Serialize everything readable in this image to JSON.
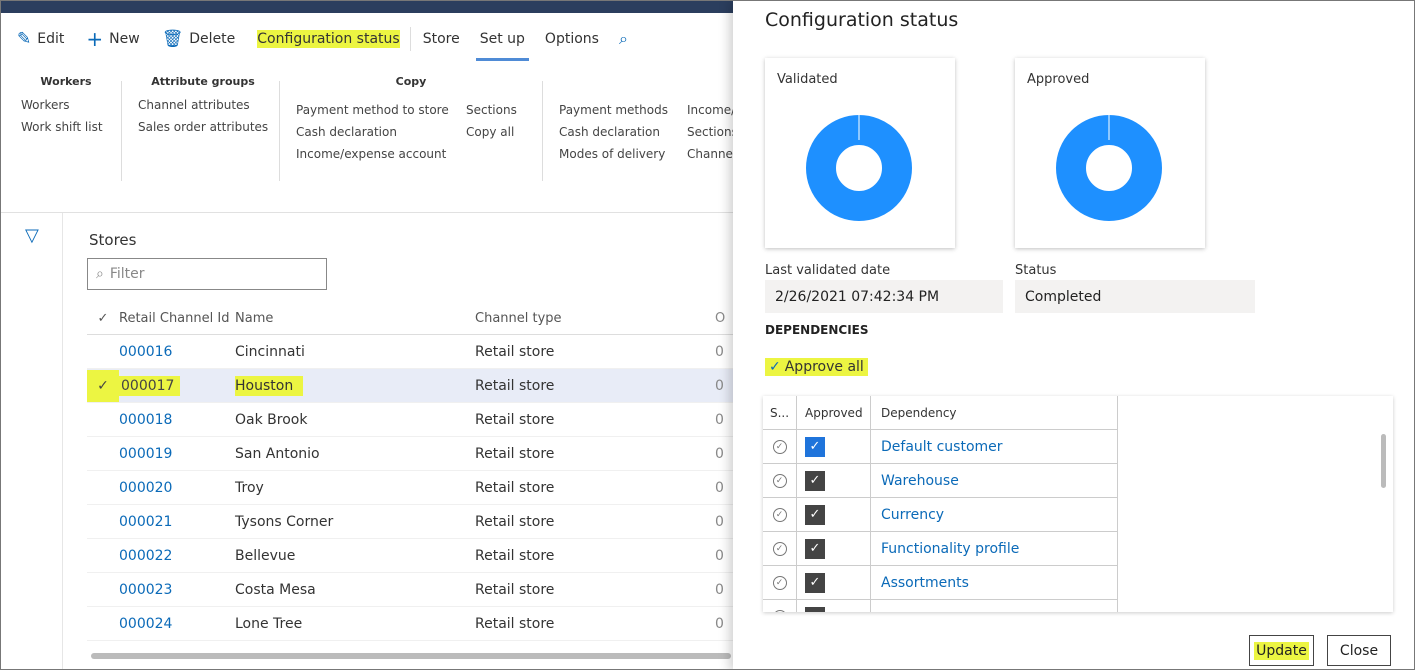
{
  "toolbar": {
    "edit": "Edit",
    "new": "New",
    "delete": "Delete",
    "config_status": "Configuration status",
    "tabs": [
      "Store",
      "Set up",
      "Options"
    ]
  },
  "ribbon": {
    "workers": {
      "header": "Workers",
      "items": [
        "Workers",
        "Work shift list"
      ]
    },
    "attribute_groups": {
      "header": "Attribute groups",
      "items": [
        "Channel attributes",
        "Sales order attributes"
      ]
    },
    "copy": {
      "header": "Copy",
      "col1": [
        "Payment method to store",
        "Cash declaration",
        "Income/expense account"
      ],
      "col2": [
        "Sections",
        "Copy all"
      ]
    },
    "col4": [
      "Payment methods",
      "Cash declaration",
      "Modes of delivery"
    ],
    "col5": [
      "Income/",
      "Sections",
      "Channe"
    ]
  },
  "stores": {
    "title": "Stores",
    "filter_placeholder": "Filter",
    "columns": [
      "Retail Channel Id",
      "Name",
      "Channel type",
      "O"
    ],
    "rows": [
      {
        "id": "000016",
        "name": "Cincinnati",
        "type": "Retail store",
        "extra": "0"
      },
      {
        "id": "000017",
        "name": "Houston",
        "type": "Retail store",
        "extra": "0"
      },
      {
        "id": "000018",
        "name": "Oak Brook",
        "type": "Retail store",
        "extra": "0"
      },
      {
        "id": "000019",
        "name": "San Antonio",
        "type": "Retail store",
        "extra": "0"
      },
      {
        "id": "000020",
        "name": "Troy",
        "type": "Retail store",
        "extra": "0"
      },
      {
        "id": "000021",
        "name": "Tysons Corner",
        "type": "Retail store",
        "extra": "0"
      },
      {
        "id": "000022",
        "name": "Bellevue",
        "type": "Retail store",
        "extra": "0"
      },
      {
        "id": "000023",
        "name": "Costa Mesa",
        "type": "Retail store",
        "extra": "0"
      },
      {
        "id": "000024",
        "name": "Lone Tree",
        "type": "Retail store",
        "extra": "0"
      }
    ]
  },
  "panel": {
    "title": "Configuration status",
    "validated_label": "Validated",
    "approved_label": "Approved",
    "last_validated_label": "Last validated date",
    "last_validated_value": "2/26/2021 07:42:34 PM",
    "status_label": "Status",
    "status_value": "Completed",
    "dependencies_header": "DEPENDENCIES",
    "approve_all": "Approve all",
    "dep_columns": [
      "S...",
      "Approved",
      "Dependency"
    ],
    "dependencies": [
      {
        "name": "Default customer",
        "approved": true,
        "highlight": true
      },
      {
        "name": "Warehouse",
        "approved": true
      },
      {
        "name": "Currency",
        "approved": true
      },
      {
        "name": "Functionality profile",
        "approved": true
      },
      {
        "name": "Assortments",
        "approved": true
      }
    ],
    "update_button": "Update",
    "close_button": "Close",
    "donut_color": "#1e90ff"
  },
  "colors": {
    "highlight": "#ecf542",
    "link": "#0b6ab8",
    "accent": "#1f74db"
  }
}
